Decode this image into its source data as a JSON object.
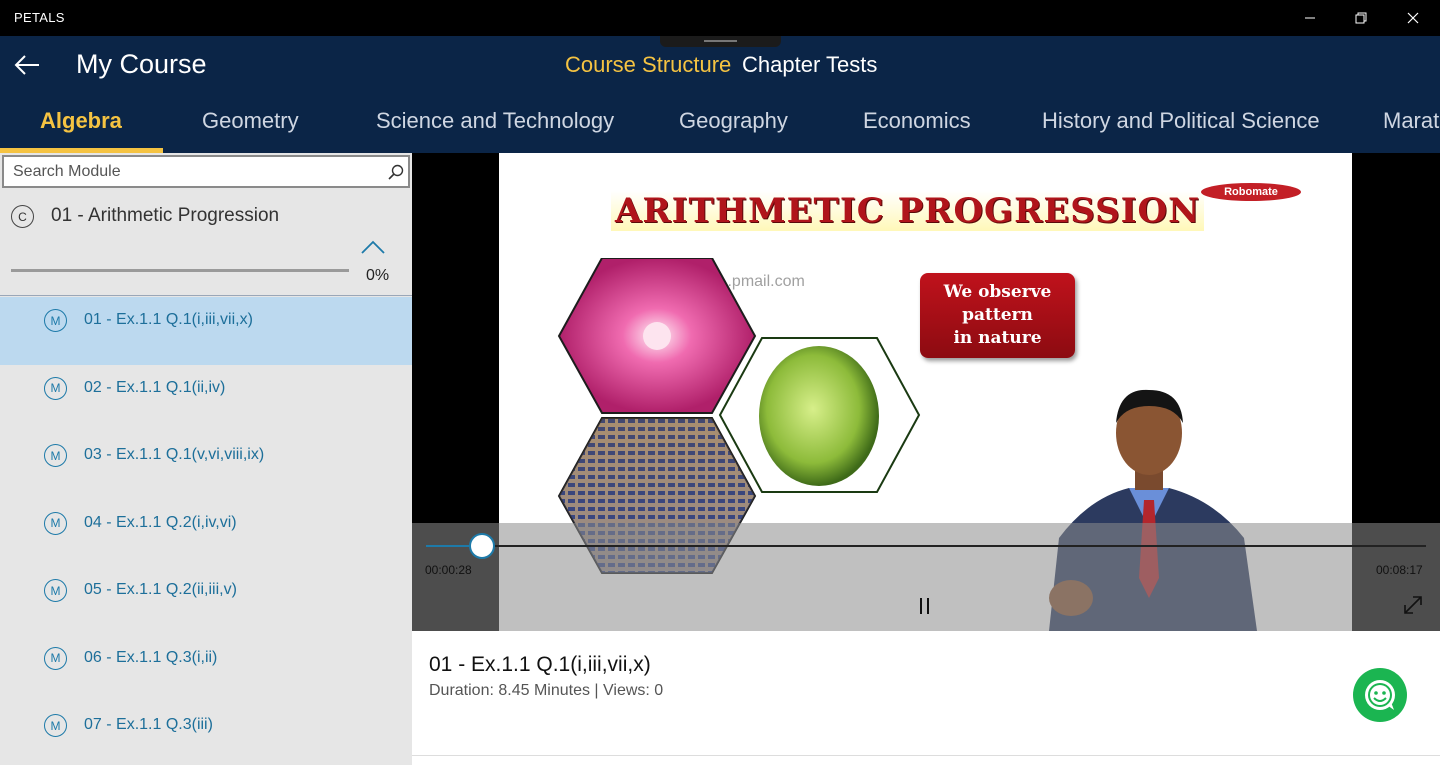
{
  "window": {
    "app_name": "PETALS"
  },
  "header": {
    "title": "My Course",
    "top_tabs": [
      {
        "label": "Course Structure",
        "active": true
      },
      {
        "label": "Chapter Tests",
        "active": false
      }
    ],
    "subjects": [
      {
        "label": "Algebra",
        "active": true
      },
      {
        "label": "Geometry",
        "active": false
      },
      {
        "label": "Science and Technology",
        "active": false
      },
      {
        "label": "Geography",
        "active": false
      },
      {
        "label": "Economics",
        "active": false
      },
      {
        "label": "History and Political Science",
        "active": false
      },
      {
        "label": "Marat",
        "active": false
      }
    ],
    "accent_color": "#f5c342",
    "background_color": "#0b2547"
  },
  "sidebar": {
    "search_placeholder": "Search Module",
    "chapter": {
      "badge": "C",
      "title": "01 - Arithmetic Progression",
      "progress_text": "0%",
      "progress_fraction": 0
    },
    "modules": [
      {
        "badge": "M",
        "label": "01 - Ex.1.1 Q.1(i,iii,vii,x)",
        "selected": true
      },
      {
        "badge": "M",
        "label": "02 - Ex.1.1 Q.1(ii,iv)",
        "selected": false
      },
      {
        "badge": "M",
        "label": "03 - Ex.1.1 Q.1(v,vi,viii,ix)",
        "selected": false
      },
      {
        "badge": "M",
        "label": "04 - Ex.1.1 Q.2(i,iv,vi)",
        "selected": false
      },
      {
        "badge": "M",
        "label": "05 - Ex.1.1 Q.2(ii,iii,v)",
        "selected": false
      },
      {
        "badge": "M",
        "label": "06 - Ex.1.1 Q.3(i,ii)",
        "selected": false
      },
      {
        "badge": "M",
        "label": "07 - Ex.1.1 Q.3(iii)",
        "selected": false
      }
    ]
  },
  "player": {
    "slide_title": "ARITHMETIC PROGRESSION",
    "brand": "Robomate",
    "watermark": "...@...pmail.com",
    "observe_text": [
      "We observe",
      "pattern",
      "in nature"
    ],
    "current_time": "00:00:28",
    "total_time": "00:08:17",
    "progress_fraction": 0.056
  },
  "video": {
    "title": "01 - Ex.1.1 Q.1(i,iii,vii,x)",
    "meta": "Duration: 8.45 Minutes | Views: 0"
  }
}
